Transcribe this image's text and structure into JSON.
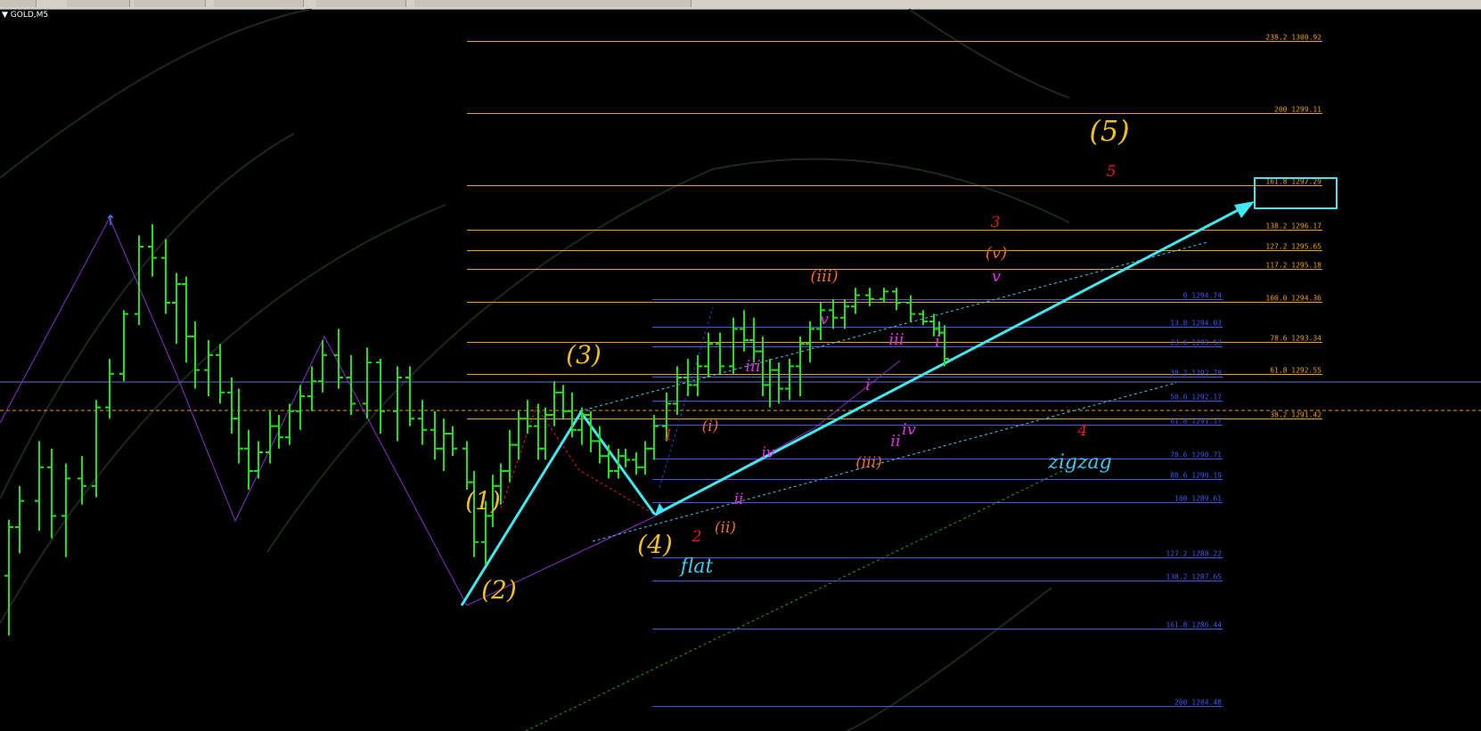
{
  "symbol": "GOLD,M5",
  "colors": {
    "background": "#000000",
    "bar": "#22e01a",
    "fib_orange": "#e8a020",
    "fib_blue": "#4058f0",
    "trend": "#40e8f0",
    "label_red": "#e02020",
    "label_orange": "#f06a28",
    "label_magenta": "#e030e0",
    "label_yellow": "#f0c020"
  },
  "chart_data": {
    "type": "ohlc",
    "symbol": "GOLD",
    "timeframe": "M5",
    "bars": [
      {
        "o": 1287.0,
        "h": 1288.5,
        "l": 1285.4,
        "c": 1288.3
      },
      {
        "o": 1288.3,
        "h": 1289.4,
        "l": 1287.6,
        "c": 1289.0
      },
      {
        "o": 1289.0,
        "h": 1290.6,
        "l": 1288.2,
        "c": 1289.9
      },
      {
        "o": 1289.9,
        "h": 1290.4,
        "l": 1288.0,
        "c": 1288.6
      },
      {
        "o": 1288.6,
        "h": 1290.0,
        "l": 1287.5,
        "c": 1289.6
      },
      {
        "o": 1289.6,
        "h": 1290.2,
        "l": 1288.9,
        "c": 1289.4
      },
      {
        "o": 1289.4,
        "h": 1291.7,
        "l": 1289.1,
        "c": 1291.5
      },
      {
        "o": 1291.5,
        "h": 1292.8,
        "l": 1291.2,
        "c": 1292.4
      },
      {
        "o": 1292.4,
        "h": 1294.1,
        "l": 1292.2,
        "c": 1294.0
      },
      {
        "o": 1294.0,
        "h": 1296.1,
        "l": 1293.7,
        "c": 1295.8
      },
      {
        "o": 1295.8,
        "h": 1296.4,
        "l": 1295.0,
        "c": 1295.5
      },
      {
        "o": 1295.5,
        "h": 1296.0,
        "l": 1294.0,
        "c": 1294.3
      },
      {
        "o": 1294.3,
        "h": 1295.1,
        "l": 1293.2,
        "c": 1294.8
      },
      {
        "o": 1294.8,
        "h": 1295.0,
        "l": 1292.7,
        "c": 1293.4
      },
      {
        "o": 1293.4,
        "h": 1293.8,
        "l": 1292.0,
        "c": 1292.5
      },
      {
        "o": 1292.5,
        "h": 1293.3,
        "l": 1291.8,
        "c": 1292.9
      },
      {
        "o": 1292.9,
        "h": 1293.2,
        "l": 1291.6,
        "c": 1291.9
      },
      {
        "o": 1291.9,
        "h": 1292.3,
        "l": 1290.8,
        "c": 1291.2
      },
      {
        "o": 1291.2,
        "h": 1292.0,
        "l": 1290.0,
        "c": 1290.4
      },
      {
        "o": 1290.4,
        "h": 1290.9,
        "l": 1289.3,
        "c": 1289.8
      },
      {
        "o": 1289.8,
        "h": 1290.6,
        "l": 1289.6,
        "c": 1290.3
      },
      {
        "o": 1290.3,
        "h": 1291.4,
        "l": 1290.0,
        "c": 1291.0
      },
      {
        "o": 1291.0,
        "h": 1291.3,
        "l": 1290.4,
        "c": 1290.7
      },
      {
        "o": 1290.7,
        "h": 1291.6,
        "l": 1290.5,
        "c": 1291.4
      },
      {
        "o": 1291.4,
        "h": 1292.1,
        "l": 1290.9,
        "c": 1291.8
      },
      {
        "o": 1291.8,
        "h": 1292.6,
        "l": 1291.4,
        "c": 1292.2
      },
      {
        "o": 1292.2,
        "h": 1293.3,
        "l": 1291.9,
        "c": 1292.9
      },
      {
        "o": 1292.9,
        "h": 1293.6,
        "l": 1292.0,
        "c": 1292.3
      },
      {
        "o": 1292.3,
        "h": 1292.9,
        "l": 1291.3,
        "c": 1291.6
      },
      {
        "o": 1291.6,
        "h": 1293.1,
        "l": 1291.2,
        "c": 1292.7
      },
      {
        "o": 1292.7,
        "h": 1292.8,
        "l": 1290.8,
        "c": 1291.4
      },
      {
        "o": 1291.4,
        "h": 1292.6,
        "l": 1290.6,
        "c": 1292.3
      },
      {
        "o": 1292.3,
        "h": 1292.6,
        "l": 1291.0,
        "c": 1291.2
      },
      {
        "o": 1291.2,
        "h": 1291.7,
        "l": 1290.5,
        "c": 1290.9
      },
      {
        "o": 1290.9,
        "h": 1291.4,
        "l": 1290.1,
        "c": 1290.4
      },
      {
        "o": 1290.4,
        "h": 1291.2,
        "l": 1289.8,
        "c": 1290.8
      },
      {
        "o": 1290.8,
        "h": 1291.0,
        "l": 1290.2,
        "c": 1290.4
      },
      {
        "o": 1290.4,
        "h": 1290.6,
        "l": 1289.3,
        "c": 1289.5
      },
      {
        "o": 1289.5,
        "h": 1289.8,
        "l": 1287.5,
        "c": 1287.9
      },
      {
        "o": 1287.9,
        "h": 1289.0,
        "l": 1287.3,
        "c": 1288.6
      },
      {
        "o": 1288.6,
        "h": 1289.7,
        "l": 1288.3,
        "c": 1289.4
      },
      {
        "o": 1289.4,
        "h": 1290.0,
        "l": 1288.9,
        "c": 1289.8
      },
      {
        "o": 1289.8,
        "h": 1290.9,
        "l": 1289.5,
        "c": 1290.5
      },
      {
        "o": 1290.5,
        "h": 1291.4,
        "l": 1290.1,
        "c": 1291.2
      },
      {
        "o": 1291.2,
        "h": 1291.7,
        "l": 1290.8,
        "c": 1291.0
      },
      {
        "o": 1291.0,
        "h": 1291.6,
        "l": 1290.1,
        "c": 1290.4
      },
      {
        "o": 1290.4,
        "h": 1291.5,
        "l": 1290.1,
        "c": 1291.3
      },
      {
        "o": 1291.3,
        "h": 1292.2,
        "l": 1291.0,
        "c": 1291.9
      },
      {
        "o": 1291.9,
        "h": 1292.1,
        "l": 1291.2,
        "c": 1291.4
      },
      {
        "o": 1291.4,
        "h": 1291.9,
        "l": 1290.7,
        "c": 1290.9
      },
      {
        "o": 1290.9,
        "h": 1291.5,
        "l": 1290.5,
        "c": 1291.3
      },
      {
        "o": 1291.3,
        "h": 1291.4,
        "l": 1290.3,
        "c": 1290.6
      },
      {
        "o": 1290.6,
        "h": 1291.0,
        "l": 1290.0,
        "c": 1290.2
      },
      {
        "o": 1290.2,
        "h": 1290.5,
        "l": 1289.6,
        "c": 1289.8
      },
      {
        "o": 1289.8,
        "h": 1290.4,
        "l": 1289.6,
        "c": 1290.2
      },
      {
        "o": 1290.2,
        "h": 1290.4,
        "l": 1289.9,
        "c": 1290.1
      },
      {
        "o": 1290.1,
        "h": 1290.3,
        "l": 1289.7,
        "c": 1289.9
      },
      {
        "o": 1289.9,
        "h": 1290.6,
        "l": 1289.7,
        "c": 1290.4
      },
      {
        "o": 1290.4,
        "h": 1291.3,
        "l": 1290.1,
        "c": 1291.0
      },
      {
        "o": 1291.0,
        "h": 1291.9,
        "l": 1290.6,
        "c": 1291.6
      },
      {
        "o": 1291.6,
        "h": 1292.6,
        "l": 1291.3,
        "c": 1292.3
      },
      {
        "o": 1292.3,
        "h": 1292.8,
        "l": 1291.8,
        "c": 1292.1
      },
      {
        "o": 1292.1,
        "h": 1292.9,
        "l": 1291.8,
        "c": 1292.6
      },
      {
        "o": 1292.6,
        "h": 1293.5,
        "l": 1292.3,
        "c": 1293.2
      },
      {
        "o": 1293.2,
        "h": 1293.5,
        "l": 1292.4,
        "c": 1292.6
      },
      {
        "o": 1292.6,
        "h": 1293.9,
        "l": 1292.4,
        "c": 1293.6
      },
      {
        "o": 1293.6,
        "h": 1294.1,
        "l": 1293.0,
        "c": 1293.3
      },
      {
        "o": 1293.3,
        "h": 1293.9,
        "l": 1292.7,
        "c": 1293.0
      },
      {
        "o": 1293.0,
        "h": 1293.4,
        "l": 1291.8,
        "c": 1292.1
      },
      {
        "o": 1292.1,
        "h": 1292.8,
        "l": 1291.5,
        "c": 1292.5
      },
      {
        "o": 1292.5,
        "h": 1292.7,
        "l": 1291.6,
        "c": 1292.0
      },
      {
        "o": 1292.0,
        "h": 1292.8,
        "l": 1291.7,
        "c": 1292.6
      },
      {
        "o": 1292.6,
        "h": 1293.4,
        "l": 1291.8,
        "c": 1293.2
      },
      {
        "o": 1293.2,
        "h": 1293.8,
        "l": 1292.7,
        "c": 1293.6
      },
      {
        "o": 1293.6,
        "h": 1294.3,
        "l": 1293.3,
        "c": 1294.1
      },
      {
        "o": 1294.1,
        "h": 1294.4,
        "l": 1293.6,
        "c": 1293.9
      },
      {
        "o": 1293.9,
        "h": 1294.4,
        "l": 1293.6,
        "c": 1294.2
      },
      {
        "o": 1294.2,
        "h": 1294.7,
        "l": 1294.0,
        "c": 1294.5
      },
      {
        "o": 1294.5,
        "h": 1294.7,
        "l": 1294.2,
        "c": 1294.4
      },
      {
        "o": 1294.4,
        "h": 1294.7,
        "l": 1294.3,
        "c": 1294.6
      },
      {
        "o": 1294.6,
        "h": 1294.7,
        "l": 1294.1,
        "c": 1294.3
      },
      {
        "o": 1294.3,
        "h": 1294.5,
        "l": 1293.8,
        "c": 1294.0
      },
      {
        "o": 1294.0,
        "h": 1294.1,
        "l": 1293.7,
        "c": 1293.8
      },
      {
        "o": 1293.8,
        "h": 1294.0,
        "l": 1293.4,
        "c": 1293.6
      },
      {
        "o": 1293.6,
        "h": 1293.8,
        "l": 1293.4,
        "c": 1293.5
      },
      {
        "o": 1293.5,
        "h": 1293.7,
        "l": 1292.6,
        "c": 1292.8
      }
    ],
    "fib_orange": [
      {
        "label": "238.2 1300.92",
        "price": 1300.92
      },
      {
        "label": "200 1299.11",
        "price": 1299.11
      },
      {
        "label": "161.8 1297.29",
        "price": 1297.29
      },
      {
        "label": "138.2 1296.17",
        "price": 1296.17
      },
      {
        "label": "127.2 1295.65",
        "price": 1295.65
      },
      {
        "label": "117.2 1295.18",
        "price": 1295.18
      },
      {
        "label": "100.0  1294.36",
        "price": 1294.36
      },
      {
        "label": "78.6 1293.34",
        "price": 1293.34
      },
      {
        "label": "61.8 1292.55",
        "price": 1292.55
      },
      {
        "label": "38.2 1291.42",
        "price": 1291.42
      }
    ],
    "fib_blue": [
      {
        "label": "0 1294.74",
        "price": 1294.74
      },
      {
        "label": "13.8 1294.03",
        "price": 1294.03
      },
      {
        "label": "23.6 1293.53",
        "price": 1293.53
      },
      {
        "label": "38.2 1292.78",
        "price": 1292.78
      },
      {
        "label": "50.0 1292.17",
        "price": 1292.17
      },
      {
        "label": "61.8 1291.57",
        "price": 1291.57
      },
      {
        "label": "78.6 1290.71",
        "price": 1290.71
      },
      {
        "label": "88.6 1290.19",
        "price": 1290.19
      },
      {
        "label": "100 1289.61",
        "price": 1289.61
      },
      {
        "label": "127.2 1288.22",
        "price": 1288.22
      },
      {
        "label": "138.2 1287.65",
        "price": 1287.65
      },
      {
        "label": "161.8 1286.44",
        "price": 1286.44
      },
      {
        "label": "200 1284.48",
        "price": 1284.48
      }
    ],
    "wave_labels": [
      {
        "t": "(1)",
        "c": "yellow",
        "s": 28
      },
      {
        "t": "(2)",
        "c": "yellow",
        "s": 28
      },
      {
        "t": "(3)",
        "c": "yellow",
        "s": 28
      },
      {
        "t": "(4)",
        "c": "yellow",
        "s": 28
      },
      {
        "t": "(5)",
        "c": "yellow",
        "s": 32
      },
      {
        "t": "1",
        "c": "red",
        "s": 17
      },
      {
        "t": "2",
        "c": "red",
        "s": 17
      },
      {
        "t": "3",
        "c": "red",
        "s": 17
      },
      {
        "t": "4",
        "c": "red",
        "s": 17
      },
      {
        "t": "5",
        "c": "red",
        "s": 17
      },
      {
        "t": "(i)",
        "c": "orange",
        "s": 17
      },
      {
        "t": "(ii)",
        "c": "orange",
        "s": 17
      },
      {
        "t": "(iii)",
        "c": "orange",
        "s": 18
      },
      {
        "t": "(iii)",
        "c": "orange",
        "s": 17
      },
      {
        "t": "(v)",
        "c": "orange",
        "s": 18
      },
      {
        "t": "i",
        "c": "magenta",
        "s": 18
      },
      {
        "t": "ii",
        "c": "magenta",
        "s": 17
      },
      {
        "t": "iii",
        "c": "magenta",
        "s": 18
      },
      {
        "t": "iv",
        "c": "magenta",
        "s": 17
      },
      {
        "t": "v",
        "c": "magenta",
        "s": 18
      },
      {
        "t": "iii",
        "c": "magenta",
        "s": 18
      },
      {
        "t": "ii",
        "c": "magenta",
        "s": 18
      },
      {
        "t": "i",
        "c": "magenta",
        "s": 18
      },
      {
        "t": "iv",
        "c": "magenta",
        "s": 18
      },
      {
        "t": "v",
        "c": "magenta",
        "s": 18
      },
      {
        "t": "flat",
        "c": "cyan",
        "s": 22
      },
      {
        "t": "zigzag",
        "c": "cyan",
        "s": 22
      }
    ]
  }
}
